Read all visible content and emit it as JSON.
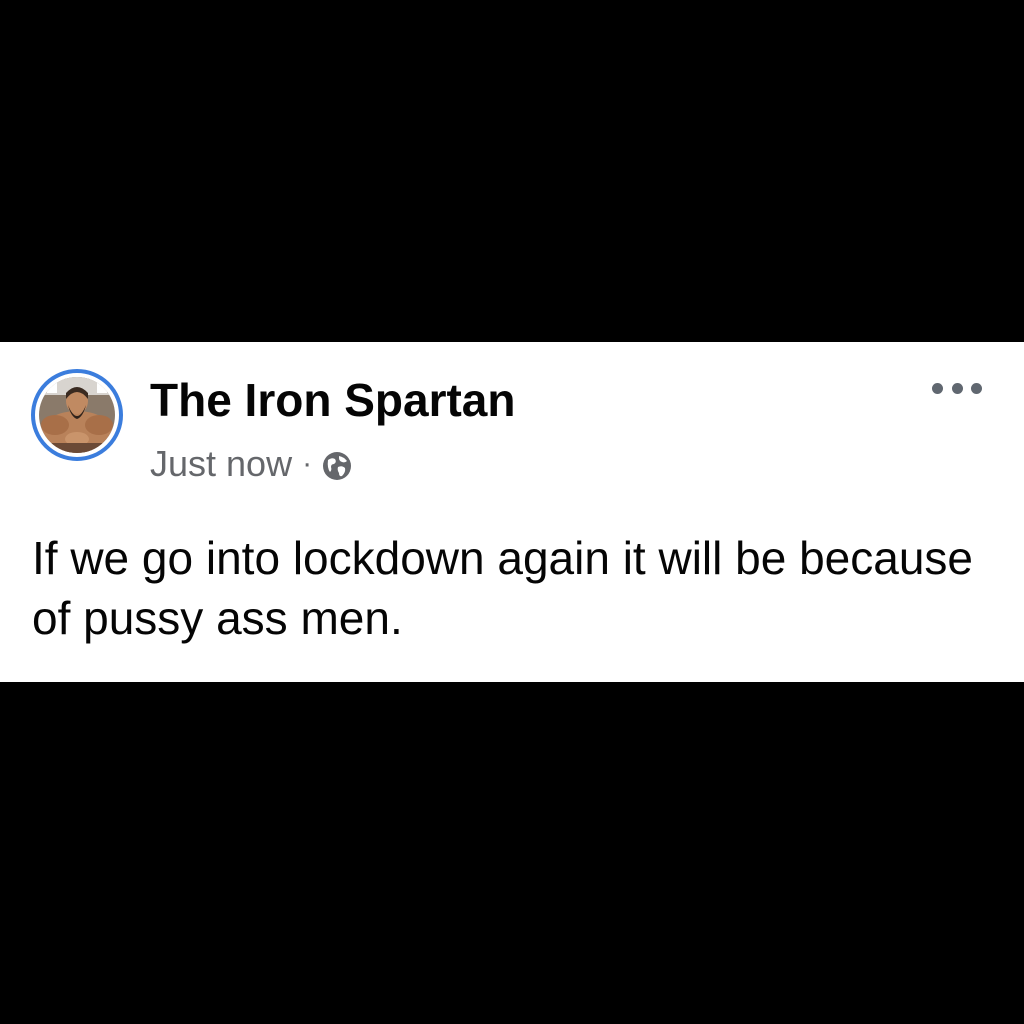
{
  "post": {
    "author": "The Iron Spartan",
    "timestamp": "Just now",
    "separator": "·",
    "privacy_icon": "globe-icon",
    "more_icon": "more-options-icon",
    "text": "If we go into lockdown again it will be because of pussy ass men."
  },
  "colors": {
    "background": "#000000",
    "card": "#ffffff",
    "avatar_ring": "#3b7ddd",
    "name_text": "#050505",
    "meta_text": "#65676b"
  }
}
